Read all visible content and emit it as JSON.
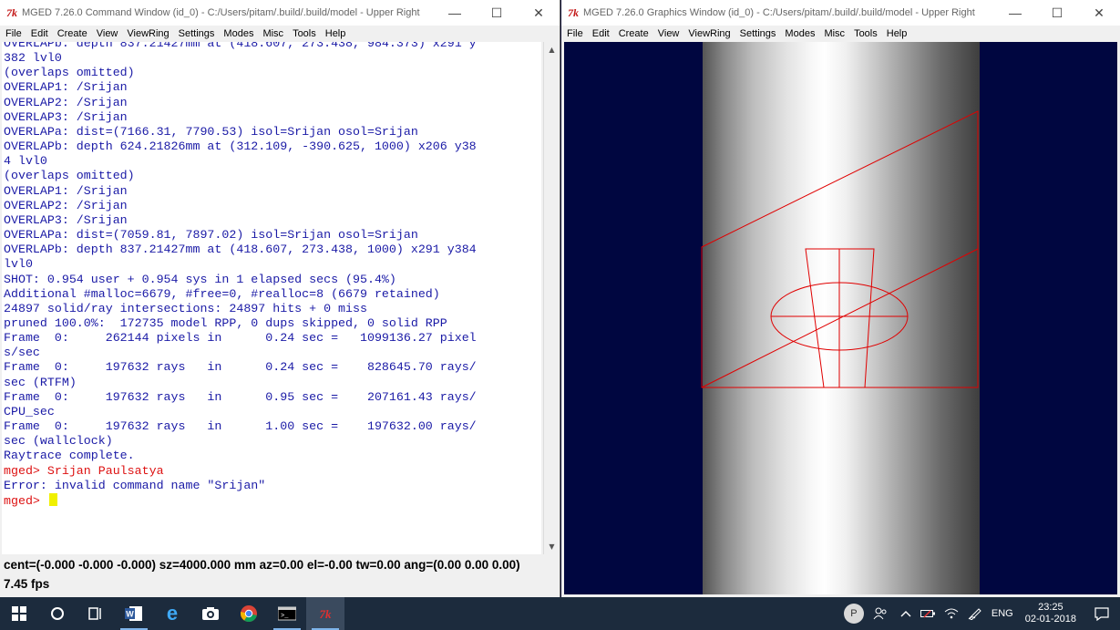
{
  "cmd_window": {
    "title": "MGED 7.26.0 Command Window (id_0) - C:/Users/pitam/.build/.build/model - Upper Right",
    "tk_icon": "7k",
    "menu": [
      "File",
      "Edit",
      "Create",
      "View",
      "ViewRing",
      "Settings",
      "Modes",
      "Misc",
      "Tools",
      "Help"
    ],
    "console_lines": [
      {
        "text": "OVERLAPb: depth 837.21427mm at (418.607, 273.438, 984.373) x291 y",
        "prompt": false
      },
      {
        "text": "382 lvl0",
        "prompt": false
      },
      {
        "text": "(overlaps omitted)",
        "prompt": false
      },
      {
        "text": "",
        "prompt": false
      },
      {
        "text": "OVERLAP1: /Srijan",
        "prompt": false
      },
      {
        "text": "OVERLAP2: /Srijan",
        "prompt": false
      },
      {
        "text": "OVERLAP3: /Srijan",
        "prompt": false
      },
      {
        "text": "OVERLAPa: dist=(7166.31, 7790.53) isol=Srijan osol=Srijan",
        "prompt": false
      },
      {
        "text": "OVERLAPb: depth 624.21826mm at (312.109, -390.625, 1000) x206 y38",
        "prompt": false
      },
      {
        "text": "4 lvl0",
        "prompt": false
      },
      {
        "text": "(overlaps omitted)",
        "prompt": false
      },
      {
        "text": "",
        "prompt": false
      },
      {
        "text": "OVERLAP1: /Srijan",
        "prompt": false
      },
      {
        "text": "OVERLAP2: /Srijan",
        "prompt": false
      },
      {
        "text": "OVERLAP3: /Srijan",
        "prompt": false
      },
      {
        "text": "OVERLAPa: dist=(7059.81, 7897.02) isol=Srijan osol=Srijan",
        "prompt": false
      },
      {
        "text": "OVERLAPb: depth 837.21427mm at (418.607, 273.438, 1000) x291 y384",
        "prompt": false
      },
      {
        "text": "lvl0",
        "prompt": false
      },
      {
        "text": "SHOT: 0.954 user + 0.954 sys in 1 elapsed secs (95.4%)",
        "prompt": false
      },
      {
        "text": "Additional #malloc=6679, #free=0, #realloc=8 (6679 retained)",
        "prompt": false
      },
      {
        "text": "24897 solid/ray intersections: 24897 hits + 0 miss",
        "prompt": false
      },
      {
        "text": "pruned 100.0%:  172735 model RPP, 0 dups skipped, 0 solid RPP",
        "prompt": false
      },
      {
        "text": "Frame  0:     262144 pixels in      0.24 sec =   1099136.27 pixel",
        "prompt": false
      },
      {
        "text": "s/sec",
        "prompt": false
      },
      {
        "text": "Frame  0:     197632 rays   in      0.24 sec =    828645.70 rays/",
        "prompt": false
      },
      {
        "text": "sec (RTFM)",
        "prompt": false
      },
      {
        "text": "Frame  0:     197632 rays   in      0.95 sec =    207161.43 rays/",
        "prompt": false
      },
      {
        "text": "CPU_sec",
        "prompt": false
      },
      {
        "text": "Frame  0:     197632 rays   in      1.00 sec =    197632.00 rays/",
        "prompt": false
      },
      {
        "text": "sec (wallclock)",
        "prompt": false
      },
      {
        "text": "",
        "prompt": false
      },
      {
        "text": "Raytrace complete.",
        "prompt": false
      },
      {
        "text": "mged> Srijan Paulsatya",
        "prompt": true
      },
      {
        "text": "Error: invalid command name \"Srijan\"",
        "prompt": false
      }
    ],
    "current_prompt": "mged> ",
    "status_line": "cent=(-0.000 -0.000 -0.000) sz=4000.000  mm  az=0.00  el=-0.00  tw=0.00  ang=(0.00 0.00 0.00)",
    "fps": "7.45 fps"
  },
  "gfx_window": {
    "title": "MGED 7.26.0 Graphics Window (id_0) - C:/Users/pitam/.build/.build/model - Upper Right",
    "tk_icon": "7k",
    "menu": [
      "File",
      "Edit",
      "Create",
      "View",
      "ViewRing",
      "Settings",
      "Modes",
      "Misc",
      "Tools",
      "Help"
    ],
    "background_color": "#000640",
    "wireframe_color": "#e00000"
  },
  "window_controls": {
    "minimize": "—",
    "maximize": "☐",
    "close": "✕"
  },
  "taskbar": {
    "apps": [
      {
        "name": "windows-start-icon",
        "glyph": "⊞"
      },
      {
        "name": "cortana-search-icon",
        "glyph": "○"
      },
      {
        "name": "task-view-icon",
        "glyph": "⧉"
      },
      {
        "name": "word-icon",
        "glyph": "W"
      },
      {
        "name": "edge-icon",
        "glyph": "e"
      },
      {
        "name": "camera-icon",
        "glyph": "◉"
      },
      {
        "name": "chrome-icon",
        "glyph": "◕"
      },
      {
        "name": "cmd-terminal-icon",
        "glyph": ">_"
      },
      {
        "name": "tk-mged-icon",
        "glyph": "7k"
      }
    ],
    "avatar_letter": "P",
    "language": "ENG",
    "time": "23:25",
    "date": "02-01-2018"
  }
}
